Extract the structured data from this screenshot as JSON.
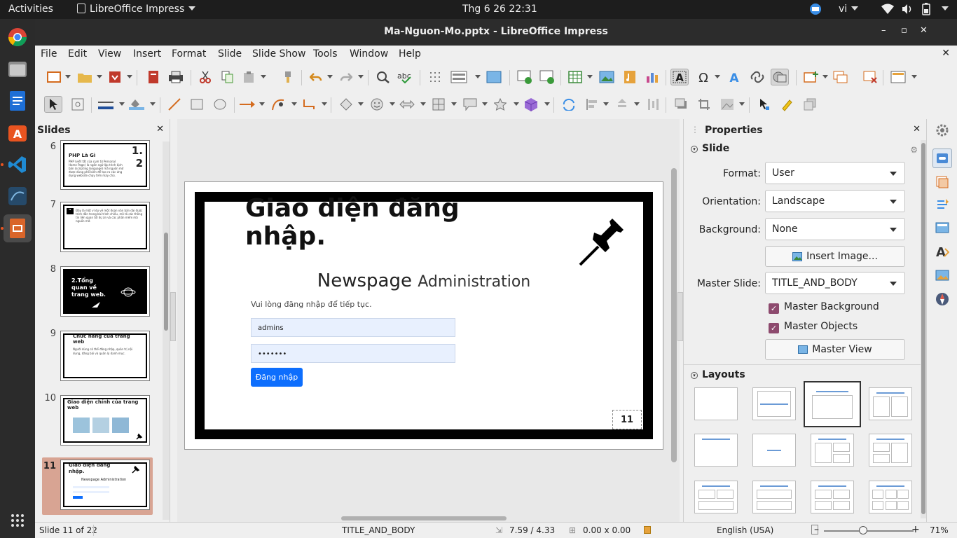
{
  "topbar": {
    "activities": "Activities",
    "app_name": "LibreOffice Impress",
    "clock": "Thg 6 26  22:31",
    "lang": "vi"
  },
  "dock": {
    "items": [
      "chrome-icon",
      "files-icon",
      "writer-icon",
      "software-center-icon",
      "vscode-icon",
      "mysql-workbench-icon",
      "impress-icon"
    ]
  },
  "window": {
    "title": "Ma-Nguon-Mo.pptx - LibreOffice Impress",
    "controls": [
      "–",
      "▫",
      "✕"
    ]
  },
  "menubar": {
    "items": [
      "File",
      "Edit",
      "View",
      "Insert",
      "Format",
      "Slide",
      "Slide Show",
      "Tools",
      "Window",
      "Help"
    ],
    "close": "✕"
  },
  "slides_pane": {
    "title": "Slides",
    "close": "✕",
    "thumbnails": [
      {
        "num": "6",
        "title": "PHP Là Gì",
        "badge": "1.\n2",
        "body": "PHP (viết tắt của cụm từ Personal Home Page) là ngôn ngữ lập trình kịch bản (scripting language) mã nguồn mở được dùng phổ biến để tạo ra các ứng dụng website chạy trên máy chủ."
      },
      {
        "num": "7",
        "title": "",
        "body": "Đây là một ví dụ về một đoạn văn bản dài được trích dẫn trong bài trình chiếu, mô tả các thông tin liên quan tới dự án và các phần mềm mã nguồn mở."
      },
      {
        "num": "8",
        "title": "2.Tổng quan về trang web.",
        "body": ""
      },
      {
        "num": "9",
        "title": "Chức năng của trang web",
        "body": "Người dùng có thể đăng nhập, quản trị nội dung, đăng bài và quản lý danh mục."
      },
      {
        "num": "10",
        "title": "Giao diện chính của trang web",
        "body": ""
      },
      {
        "num": "11",
        "title": "Giao diện đăng nhập.",
        "body": "Newspage Administration"
      }
    ]
  },
  "slide": {
    "title": "Giao diện đăng nhập.",
    "heading_strong": "Newspage",
    "heading_light": "Administration",
    "subtitle": "Vui lòng đăng nhập để tiếp tục.",
    "username_value": "admins",
    "password_value": "•••••••",
    "login_button": "Đăng nhập",
    "slide_number": "11"
  },
  "properties": {
    "title": "Properties",
    "close": "✕",
    "slide_section": "Slide",
    "format_label": "Format:",
    "format_value": "User",
    "orientation_label": "Orientation:",
    "orientation_value": "Landscape",
    "background_label": "Background:",
    "background_value": "None",
    "insert_image": "Insert Image...",
    "master_slide_label": "Master Slide:",
    "master_slide_value": "TITLE_AND_BODY",
    "master_background": "Master Background",
    "master_objects": "Master Objects",
    "master_view": "Master View",
    "layouts_section": "Layouts"
  },
  "statusbar": {
    "slide_info": "Slide 11 of 22",
    "master": "TITLE_AND_BODY",
    "position": "7.59 / 4.33",
    "size": "0.00 x 0.00",
    "language": "English (USA)",
    "zoom": "71%",
    "zoom_minus": "–",
    "zoom_plus": "+"
  },
  "colors": {
    "accent": "#e95420",
    "selection": "#d8a493",
    "checkbox": "#8d4a6e",
    "login_button": "#0d6efd"
  }
}
